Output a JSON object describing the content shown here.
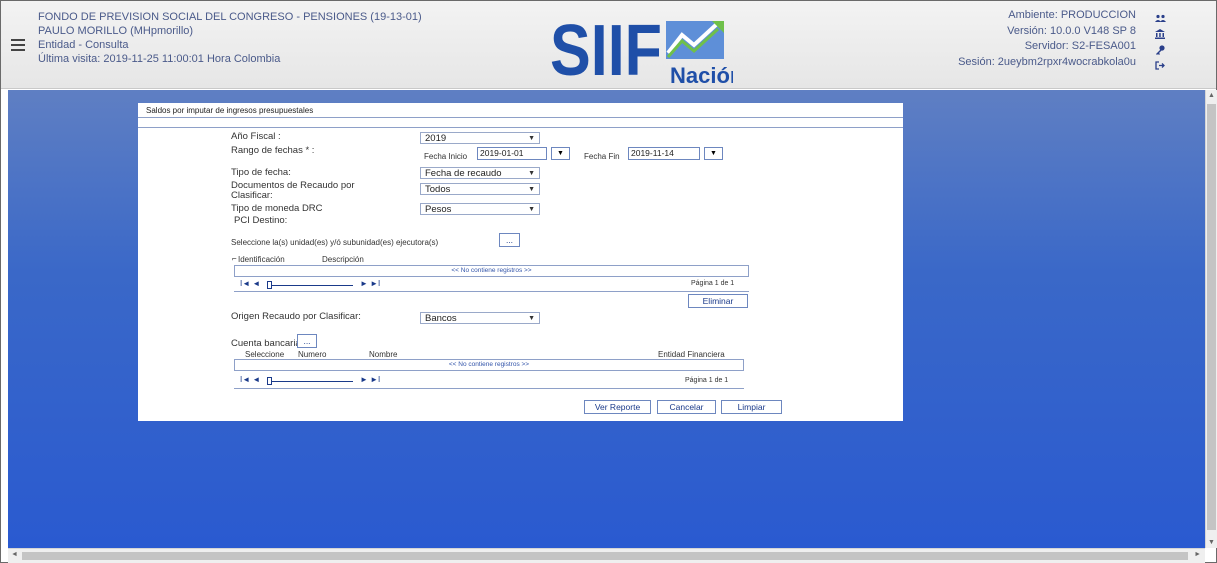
{
  "header": {
    "entity_line": "FONDO DE PREVISION SOCIAL DEL CONGRESO - PENSIONES (19-13-01)",
    "user_line": "PAULO MORILLO (MHpmorillo)",
    "role_line": "Entidad - Consulta",
    "last_visit": "Última visita: 2019-11-25 11:00:01 Hora Colombia",
    "logo_text": "SIIF",
    "logo_sub": "Nación",
    "ambiente": "Ambiente: PRODUCCION",
    "version": "Versión: 10.0.0 V148 SP 8",
    "servidor": "Servidor: S2-FESA001",
    "sesion": "Sesión: 2ueybm2rpxr4wocrabkola0u",
    "icons": [
      "users-icon",
      "bank-icon",
      "key-icon",
      "logout-icon"
    ]
  },
  "panel": {
    "title": "Saldos por imputar de ingresos presupuestales",
    "anio_fiscal_label": "Año Fiscal :",
    "anio_fiscal_value": "2019",
    "rango_label": "Rango de fechas * :",
    "fecha_inicio_label": "Fecha Inicio",
    "fecha_inicio_value": "2019-01-01",
    "fecha_fin_label": "Fecha Fin",
    "fecha_fin_value": "2019-11-14",
    "tipo_fecha_label": "Tipo de fecha:",
    "tipo_fecha_value": "Fecha de recaudo",
    "docs_label_1": "Documentos de Recaudo por",
    "docs_label_2": "Clasificar:",
    "docs_value": "Todos",
    "moneda_label": "Tipo de moneda DRC",
    "moneda_value": "Pesos",
    "pci_label": "PCI Destino:",
    "unidades_label": "Seleccione la(s) unidad(es) y/ó subunidad(es) ejecutora(s)",
    "browse_label": "...",
    "grid1": {
      "col_id": "Identificación",
      "col_desc": "Descripción",
      "empty": "<< No contiene registros >>",
      "page": "Página 1 de 1"
    },
    "eliminar": "Eliminar",
    "origen_label": "Origen Recaudo por Clasificar:",
    "origen_value": "Bancos",
    "cuenta_label": "Cuenta bancaria:",
    "grid2": {
      "col_sel": "Seleccione",
      "col_num": "Numero",
      "col_nombre": "Nombre",
      "col_entidad": "Entidad Financiera",
      "empty": "<< No contiene registros >>",
      "page": "Página 1 de 1"
    },
    "ver_reporte": "Ver Reporte",
    "cancelar": "Cancelar",
    "limpiar": "Limpiar"
  },
  "colors": {
    "header_text": "#4a5a8a",
    "background_blue": "#2a5ad0",
    "link_blue": "#1a3a8a"
  }
}
